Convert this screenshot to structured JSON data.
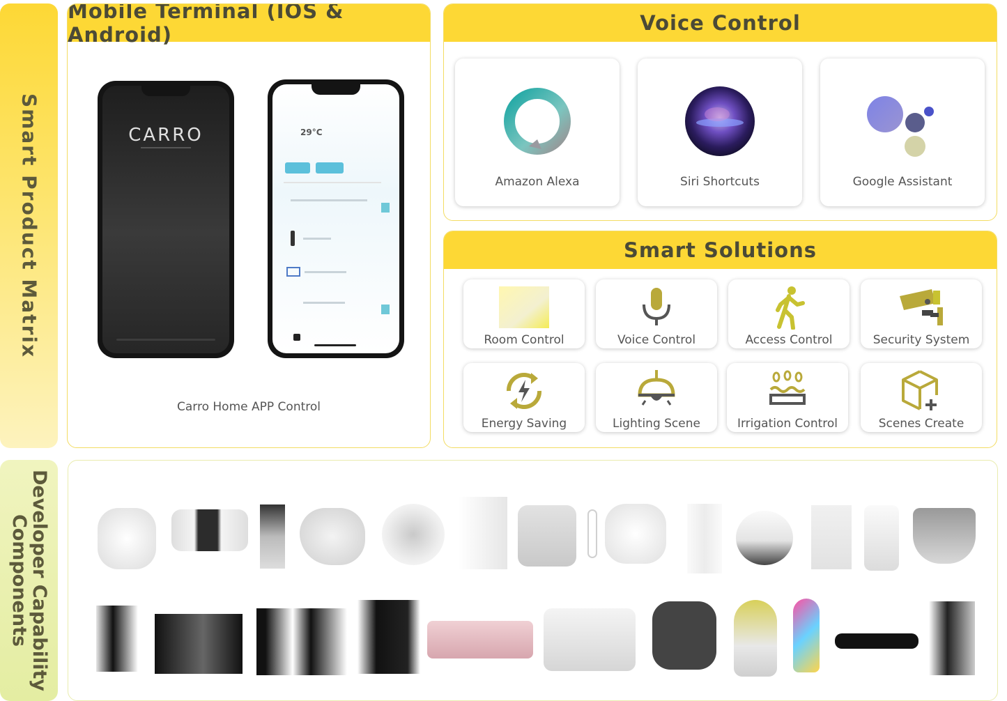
{
  "side": {
    "top_label": "Smart Product Matrix",
    "bottom_label_line1": "Developer Capability",
    "bottom_label_line2": "Components"
  },
  "mobile": {
    "title": "Mobile Terminal (IOS & Android)",
    "caption": "Carro Home APP Control",
    "brand_text": "CARRO",
    "screen_temperature": "29°C"
  },
  "voice": {
    "title": "Voice Control",
    "items": [
      {
        "label": "Amazon Alexa",
        "icon": "alexa-icon"
      },
      {
        "label": "Siri Shortcuts",
        "icon": "siri-icon"
      },
      {
        "label": "Google Assistant",
        "icon": "google-assistant-icon"
      }
    ]
  },
  "smart": {
    "title": "Smart Solutions",
    "items": [
      {
        "label": "Room Control",
        "icon": "room-icon"
      },
      {
        "label": "Voice Control",
        "icon": "microphone-icon"
      },
      {
        "label": "Access Control",
        "icon": "walking-person-icon"
      },
      {
        "label": "Security System",
        "icon": "cctv-camera-icon"
      },
      {
        "label": "Energy Saving",
        "icon": "energy-cycle-icon"
      },
      {
        "label": "Lighting Scene",
        "icon": "ceiling-lamp-icon"
      },
      {
        "label": "Irrigation Control",
        "icon": "irrigation-icon"
      },
      {
        "label": "Scenes Create",
        "icon": "cube-plus-icon"
      }
    ]
  },
  "colors": {
    "accent_yellow": "#fdd835",
    "gold_icon": "#b9a93a",
    "text_dark": "#4b4a36"
  }
}
